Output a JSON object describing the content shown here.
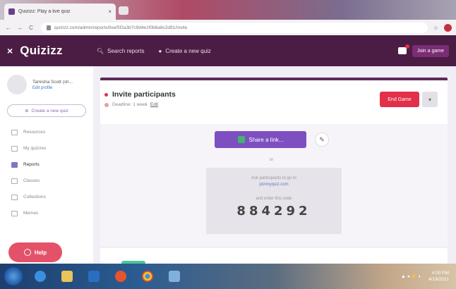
{
  "browser": {
    "tab_title": "Quizizz: Play a live quiz",
    "tab_close": "×",
    "url": "quizizz.com/admin/reports/live/5f2a3b7c9d4e1f0b6a8c2d91/invite",
    "back": "←",
    "forward": "→",
    "reload": "C",
    "star": "☆"
  },
  "header": {
    "close": "×",
    "logo": "Quizizz",
    "search_reports": "Search reports",
    "create_quiz": "Create a new quiz",
    "join_game": "Join a game"
  },
  "sidebar": {
    "profile_name": "Tamisha Scott (sh...",
    "profile_link": "Edit profile",
    "create_label": "Create a new quiz",
    "items": [
      {
        "label": "Resources",
        "active": false
      },
      {
        "label": "My quizzes",
        "active": false
      },
      {
        "label": "Reports",
        "active": true
      },
      {
        "label": "Classes",
        "active": false
      },
      {
        "label": "Collections",
        "active": false
      },
      {
        "label": "Memes",
        "active": false
      }
    ],
    "help_label": "Help"
  },
  "invite": {
    "title": "Invite participants",
    "subtitle": "Deadline: 1 week",
    "edit_label": "Edit",
    "end_button": "End Game",
    "more_icon": "▾",
    "share_label": "Share a link...",
    "or_text": "or",
    "instruction_1": "Ask participants to go to",
    "join_url": "joinmyquiz.com",
    "instruction_2": "and enter this code",
    "code": "884292"
  },
  "taskbar": {
    "time": "4:00 PM",
    "date": "4/19/2021",
    "tray": "▲ ◂ ⚡ ◐"
  },
  "colors": {
    "header": "#4b1d44",
    "accent_purple": "#7e4fc1",
    "danger_red": "#e2304a",
    "help_pink": "#e35268"
  }
}
